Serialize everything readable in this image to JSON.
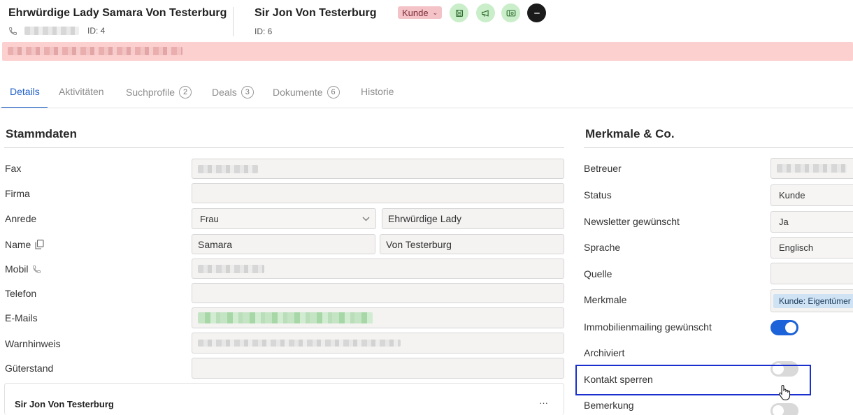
{
  "header": {
    "contact1": {
      "name": "Ehrwürdige Lady Samara Von Testerburg",
      "id": "ID: 4"
    },
    "contact2": {
      "name": "Sir Jon Von Testerburg",
      "id": "ID: 6"
    },
    "status_badge": "Kunde",
    "actions": [
      "save-icon",
      "megaphone-icon",
      "ticket-icon",
      "avatar"
    ]
  },
  "tabs": [
    {
      "label": "Details",
      "active": true
    },
    {
      "label": "Aktivitäten"
    },
    {
      "label": "Suchprofile",
      "count": "2"
    },
    {
      "label": "Deals",
      "count": "3"
    },
    {
      "label": "Dokumente",
      "count": "6"
    },
    {
      "label": "Historie"
    }
  ],
  "stammdaten": {
    "title": "Stammdaten",
    "labels": {
      "fax": "Fax",
      "firma": "Firma",
      "anrede": "Anrede",
      "name": "Name",
      "mobil": "Mobil",
      "telefon": "Telefon",
      "emails": "E-Mails",
      "warnhinweis": "Warnhinweis",
      "gueterstand": "Güterstand"
    },
    "anrede_value": "Frau",
    "titel_value": "Ehrwürdige Lady",
    "vorname": "Samara",
    "nachname": "Von Testerburg"
  },
  "related_card": {
    "title": "Sir Jon Von Testerburg",
    "menu": "···"
  },
  "merkmale": {
    "title": "Merkmale & Co.",
    "labels": {
      "betreuer": "Betreuer",
      "status": "Status",
      "newsletter": "Newsletter gewünscht",
      "sprache": "Sprache",
      "quelle": "Quelle",
      "merkmale": "Merkmale",
      "immobilienmailing": "Immobilienmailing gewünscht",
      "archiviert": "Archiviert",
      "kontakt_sperren": "Kontakt sperren",
      "bemerkung": "Bemerkung"
    },
    "status_value": "Kunde",
    "newsletter_value": "Ja",
    "sprache_value": "Englisch",
    "merkmal_tag": "Kunde: Eigentümer L",
    "toggles": {
      "immobilienmailing": true,
      "archiviert": false,
      "kontakt_sperren": false
    }
  },
  "colors": {
    "accent": "#1c62d8",
    "alert_bg": "#fdd0d0",
    "badge_bg": "#f4c3c8",
    "action_bg": "#c9eec9",
    "highlight": "#1b2fcf"
  }
}
